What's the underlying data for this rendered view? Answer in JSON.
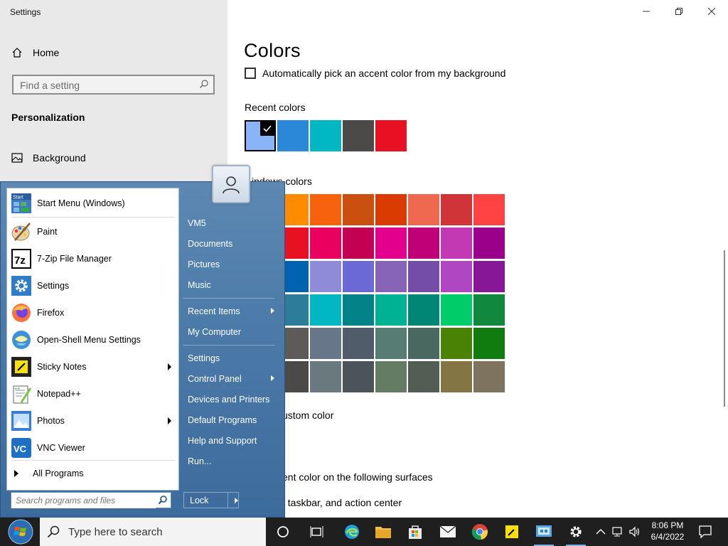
{
  "settings": {
    "window_title": "Settings",
    "nav_home": "Home",
    "search_placeholder": "Find a setting",
    "section": "Personalization",
    "nav_background": "Background",
    "page_title": "Colors",
    "auto_accent_label": "Automatically pick an accent color from my background",
    "recent_label": "Recent colors",
    "recent_colors": [
      "#8ab4f8",
      "#2b88d8",
      "#00b7c3",
      "#4c4a48",
      "#e81123"
    ],
    "windows_colors_label": "Windows colors",
    "windows_colors_visible_label": "indows colors",
    "windows_colors": [
      [
        "#ff8c00",
        "#f7630c",
        "#ca5010",
        "#da3b01",
        "#ef6950",
        "#d13438",
        "#ff4343"
      ],
      [
        "#e81123",
        "#ea005e",
        "#c30052",
        "#e3008c",
        "#bf0077",
        "#c239b3",
        "#9a0089"
      ],
      [
        "#0063b1",
        "#8e8cd8",
        "#6b69d6",
        "#8764b8",
        "#744da9",
        "#b146c2",
        "#881798"
      ],
      [
        "#2d7d9a",
        "#00b7c3",
        "#038387",
        "#00b294",
        "#018574",
        "#00cc6a",
        "#10893e"
      ],
      [
        "#5d5a58",
        "#68768a",
        "#515c6b",
        "#567c73",
        "#486860",
        "#498205",
        "#107c10"
      ],
      [
        "#4c4a48",
        "#69797e",
        "#4a5459",
        "#647c64",
        "#525e54",
        "#847545",
        "#7e735f"
      ]
    ],
    "custom_color_label": "ustom color",
    "surfaces_label": "ent color on the following surfaces",
    "surface_item": ", taskbar, and action center"
  },
  "start_menu": {
    "programs": [
      {
        "label": "Start Menu (Windows)",
        "icon": "start-menu-icon",
        "arrow": false
      },
      {
        "label": "Paint",
        "icon": "paint-icon",
        "arrow": false
      },
      {
        "label": "7-Zip File Manager",
        "icon": "7zip-icon",
        "arrow": false
      },
      {
        "label": "Settings",
        "icon": "settings-gear-icon",
        "arrow": false
      },
      {
        "label": "Firefox",
        "icon": "firefox-icon",
        "arrow": false
      },
      {
        "label": "Open-Shell Menu Settings",
        "icon": "open-shell-icon",
        "arrow": false
      },
      {
        "label": "Sticky Notes",
        "icon": "sticky-notes-icon",
        "arrow": true
      },
      {
        "label": "Notepad++",
        "icon": "notepadpp-icon",
        "arrow": false
      },
      {
        "label": "Photos",
        "icon": "photos-icon",
        "arrow": true
      },
      {
        "label": "VNC Viewer",
        "icon": "vnc-icon",
        "arrow": false
      }
    ],
    "all_programs": "All Programs",
    "search_placeholder": "Search programs and files",
    "right_items": [
      {
        "label": "VM5",
        "arrow": false
      },
      {
        "label": "Documents",
        "arrow": false
      },
      {
        "label": "Pictures",
        "arrow": false
      },
      {
        "label": "Music",
        "arrow": false
      },
      {
        "label": "Recent Items",
        "arrow": true
      },
      {
        "label": "My Computer",
        "arrow": false
      },
      {
        "label": "Settings",
        "arrow": false
      },
      {
        "label": "Control Panel",
        "arrow": true
      },
      {
        "label": "Devices and Printers",
        "arrow": false
      },
      {
        "label": "Default Programs",
        "arrow": false
      },
      {
        "label": "Help and Support",
        "arrow": false
      },
      {
        "label": "Run...",
        "arrow": false
      }
    ],
    "lock_label": "Lock"
  },
  "taskbar": {
    "search_label": "Type here to search",
    "time": "8:06 PM",
    "date": "6/4/2022"
  }
}
